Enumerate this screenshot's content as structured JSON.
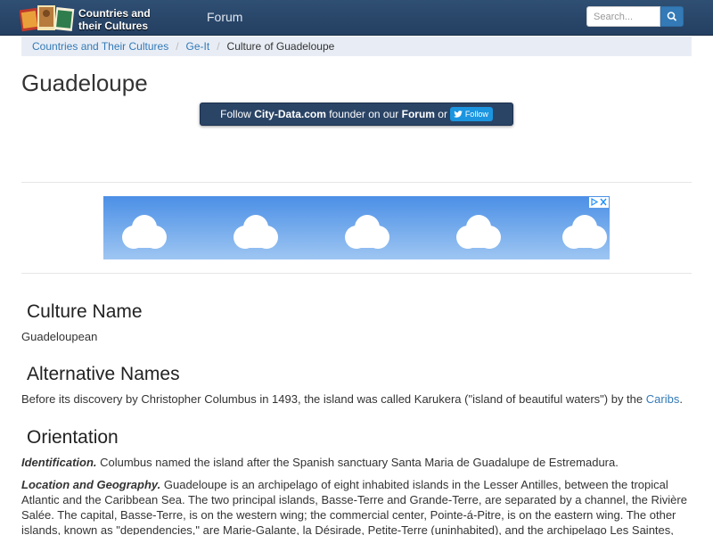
{
  "navbar": {
    "logo_line1": "Countries and",
    "logo_line2": "their Cultures",
    "forum_link": "Forum",
    "search_placeholder": "Search...",
    "search_icon": "search-icon"
  },
  "breadcrumb": {
    "items": [
      "Countries and Their Cultures",
      "Ge-It",
      "Culture of Guadeloupe"
    ],
    "separator": "/"
  },
  "page": {
    "title": "Guadeloupe"
  },
  "follow": {
    "prefix": "Follow ",
    "site": "City-Data.com",
    "middle": " founder on our ",
    "forum": "Forum",
    "or": " or ",
    "twitter_label": "Follow"
  },
  "sections": {
    "culture_name": {
      "heading": "Culture Name",
      "text": "Guadeloupean"
    },
    "alternative_names": {
      "heading": "Alternative Names",
      "text_before": "Before its discovery by Christopher Columbus in 1493, the island was called Karukera (\"island of beautiful waters\") by the ",
      "link": "Caribs",
      "text_after": "."
    },
    "orientation": {
      "heading": "Orientation",
      "identification_lead": "Identification.",
      "identification_text": " Columbus named the island after the Spanish sanctuary Santa Maria de Guadalupe de Estremadura.",
      "location_lead": "Location and Geography.",
      "location_text": " Guadeloupe is an archipelago of eight inhabited islands in the Lesser Antilles, between the tropical Atlantic and the Caribbean Sea. The two principal islands, Basse-Terre and Grande-Terre, are separated by a channel, the Rivière Salée. The capital, Basse-Terre, is on the western wing; the commercial center, Pointe-á-Pitre, is on the eastern wing. The other islands, known as \"dependencies,\" are Marie-Galante, la Désirade, Petite-Terre (uninhabited), and the archipelago Les Saintes, along with Saint"
    }
  },
  "colors": {
    "navbar": "#243f61",
    "link": "#337ab7",
    "breadcrumb_bg": "#e8edf5",
    "twitter": "#1b95e0"
  }
}
